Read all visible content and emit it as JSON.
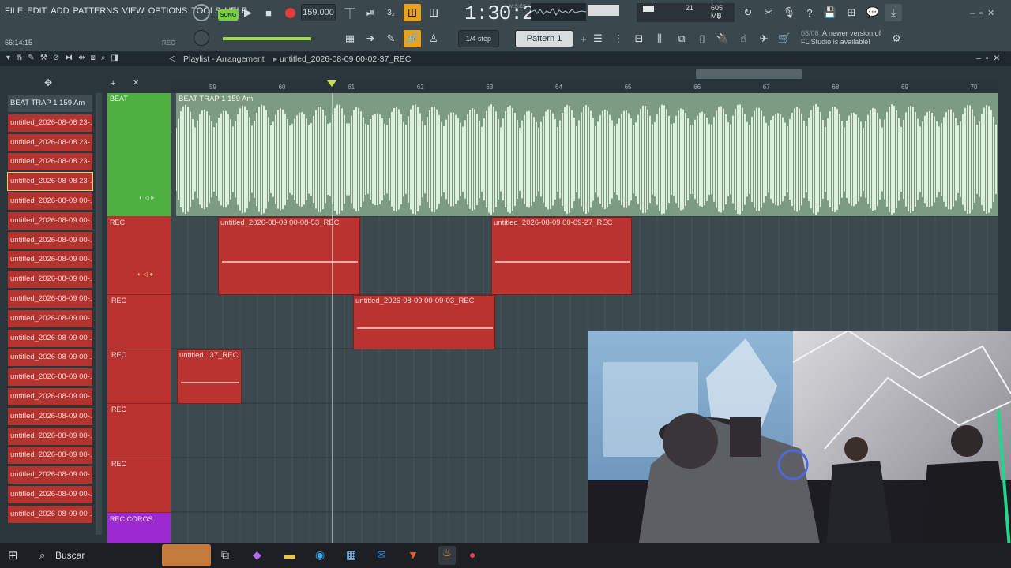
{
  "menu": [
    "FILE",
    "EDIT",
    "ADD",
    "PATTERNS",
    "VIEW",
    "OPTIONS",
    "TOOLS",
    "HELP"
  ],
  "transport": {
    "mode": "SONG",
    "tempo": "159.000",
    "time": "1:30:22",
    "time_label": "M:S:CS",
    "rec_label": "REC",
    "position_small": "66:14:15"
  },
  "cpu": {
    "value1": "21",
    "memory": "605 MB",
    "value2": "0"
  },
  "snap": "1/4 step",
  "pattern": "Pattern 1",
  "news": {
    "date": "08/08",
    "text1": "A newer version of",
    "text2": "FL Studio is available!"
  },
  "playlist": {
    "title": "Playlist - Arrangement",
    "file": "untitled_2026-08-09 00-02-37_REC"
  },
  "ruler_numbers": [
    "59",
    "60",
    "61",
    "62",
    "63",
    "64",
    "65",
    "66",
    "67",
    "68",
    "69",
    "70"
  ],
  "patterns": [
    "BEAT TRAP 1 159 Am",
    "untitled_2026-08-08 23-...",
    "untitled_2026-08-08 23-...",
    "untitled_2026-08-08 23-...",
    "untitled_2026-08-08 23-...",
    "untitled_2026-08-09 00-...",
    "untitled_2026-08-09 00-...",
    "untitled_2026-08-09 00-...",
    "untitled_2026-08-09 00-...",
    "untitled_2026-08-09 00-...",
    "untitled_2026-08-09 00-...",
    "untitled_2026-08-09 00-...",
    "untitled_2026-08-09 00-...",
    "untitled_2026-08-09 00-...",
    "untitled_2026-08-09 00-...",
    "untitled_2026-08-09 00-...",
    "untitled_2026-08-09 00-...",
    "untitled_2026-08-09 00-...",
    "untitled_2026-08-09 00-...",
    "untitled_2026-08-09 00-...",
    "untitled_2026-08-09 00-...",
    "untitled_2026-08-09 00-..."
  ],
  "tracks": [
    {
      "name": "BEAT"
    },
    {
      "name": "REC"
    },
    {
      "name": "REC"
    },
    {
      "name": "REC"
    },
    {
      "name": "REC"
    },
    {
      "name": "REC"
    },
    {
      "name": "REC COROS"
    }
  ],
  "clips": {
    "beat": "BEAT TRAP 1 159 Am",
    "c1": "untitled_2026-08-09 00-08-53_REC",
    "c2": "untitled_2026-08-09 00-09-27_REC",
    "c3": "untitled_2026-08-09 00-09-03_REC",
    "c4": "untitled...37_REC"
  },
  "taskbar": {
    "search": "Buscar"
  },
  "colors": {
    "accent_green": "#4caf3f",
    "clip_red": "#b93330",
    "topbar": "#3a474d"
  }
}
